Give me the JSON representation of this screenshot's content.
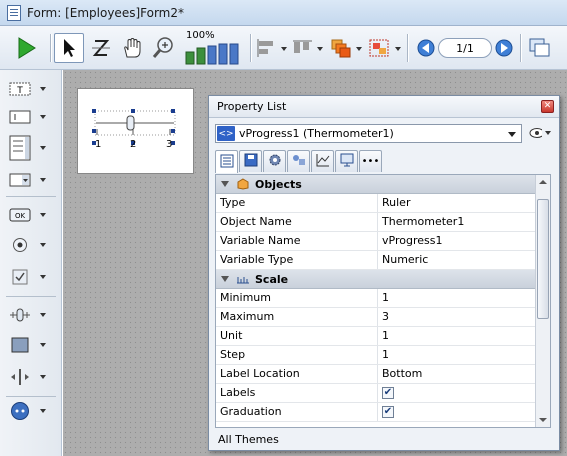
{
  "window": {
    "title": "Form: [Employees]Form2*"
  },
  "toolbar": {
    "zoom_label": "100%",
    "page_counter": "1/1",
    "icons": [
      "run-icon",
      "arrow-select-icon",
      "z-order-icon",
      "hand-icon",
      "zoom-icon",
      "bar-level-icon",
      "align-icon",
      "distribute-icon",
      "layers-icon",
      "group-icon",
      "prev-page-icon",
      "next-page-icon",
      "view-pages-icon"
    ]
  },
  "palette": {
    "icons": [
      "text-area-icon",
      "input-field-icon",
      "list-box-icon",
      "combo-box-icon",
      "button-icon",
      "radio-button-icon",
      "check-box-icon",
      "ruler-icon",
      "rectangle-icon",
      "splitter-icon",
      "plugin-icon"
    ]
  },
  "form_object": {
    "ticks": [
      "1",
      "2",
      "3"
    ]
  },
  "property_list": {
    "title": "Property List",
    "selected_object": "vProgress1 (Thermometer1)",
    "tab_icons": [
      "list-view-icon",
      "save-icon",
      "gear-icon",
      "shapes-icon",
      "chart-icon",
      "display-icon",
      "more-icon"
    ],
    "sections": [
      {
        "name": "Objects",
        "rows": [
          {
            "key": "Type",
            "value": "Ruler"
          },
          {
            "key": "Object Name",
            "value": "Thermometer1"
          },
          {
            "key": "Variable Name",
            "value": "vProgress1"
          },
          {
            "key": "Variable Type",
            "value": "Numeric"
          }
        ]
      },
      {
        "name": "Scale",
        "rows": [
          {
            "key": "Minimum",
            "value": "1"
          },
          {
            "key": "Maximum",
            "value": "3"
          },
          {
            "key": "Unit",
            "value": "1"
          },
          {
            "key": "Step",
            "value": "1"
          },
          {
            "key": "Label Location",
            "value": "Bottom"
          },
          {
            "key": "Labels",
            "checked": true
          },
          {
            "key": "Graduation",
            "checked": true
          }
        ]
      }
    ],
    "footer": "All Themes"
  }
}
